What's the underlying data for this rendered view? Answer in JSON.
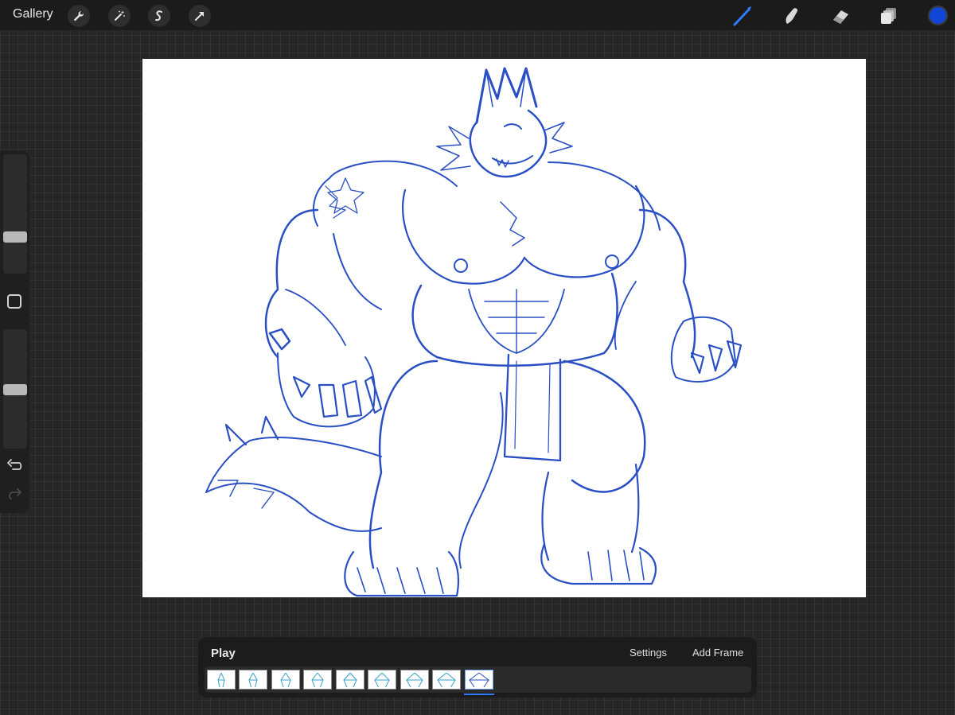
{
  "toolbar": {
    "gallery_label": "Gallery",
    "left_tools": [
      "wrench-icon",
      "magic-wand-icon",
      "selection-icon",
      "transform-icon"
    ],
    "right_tools": [
      "brush-icon",
      "smudge-icon",
      "eraser-icon",
      "layers-icon"
    ],
    "active_tool": "brush-icon",
    "accent_color": "#2f7bff",
    "current_color": "#1145d6"
  },
  "sidebar": {
    "brush_size_level": 0.3,
    "opacity_level": 0.5,
    "modify_icon": "square-icon",
    "undo_icon": "undo-icon",
    "redo_icon": "redo-icon"
  },
  "canvas": {
    "background": "#ffffff",
    "stroke_color": "#2a4fc4",
    "subject": "sketch"
  },
  "animation": {
    "play_label": "Play",
    "settings_label": "Settings",
    "add_frame_label": "Add Frame",
    "frame_count": 9,
    "selected_frame_index": 8
  }
}
